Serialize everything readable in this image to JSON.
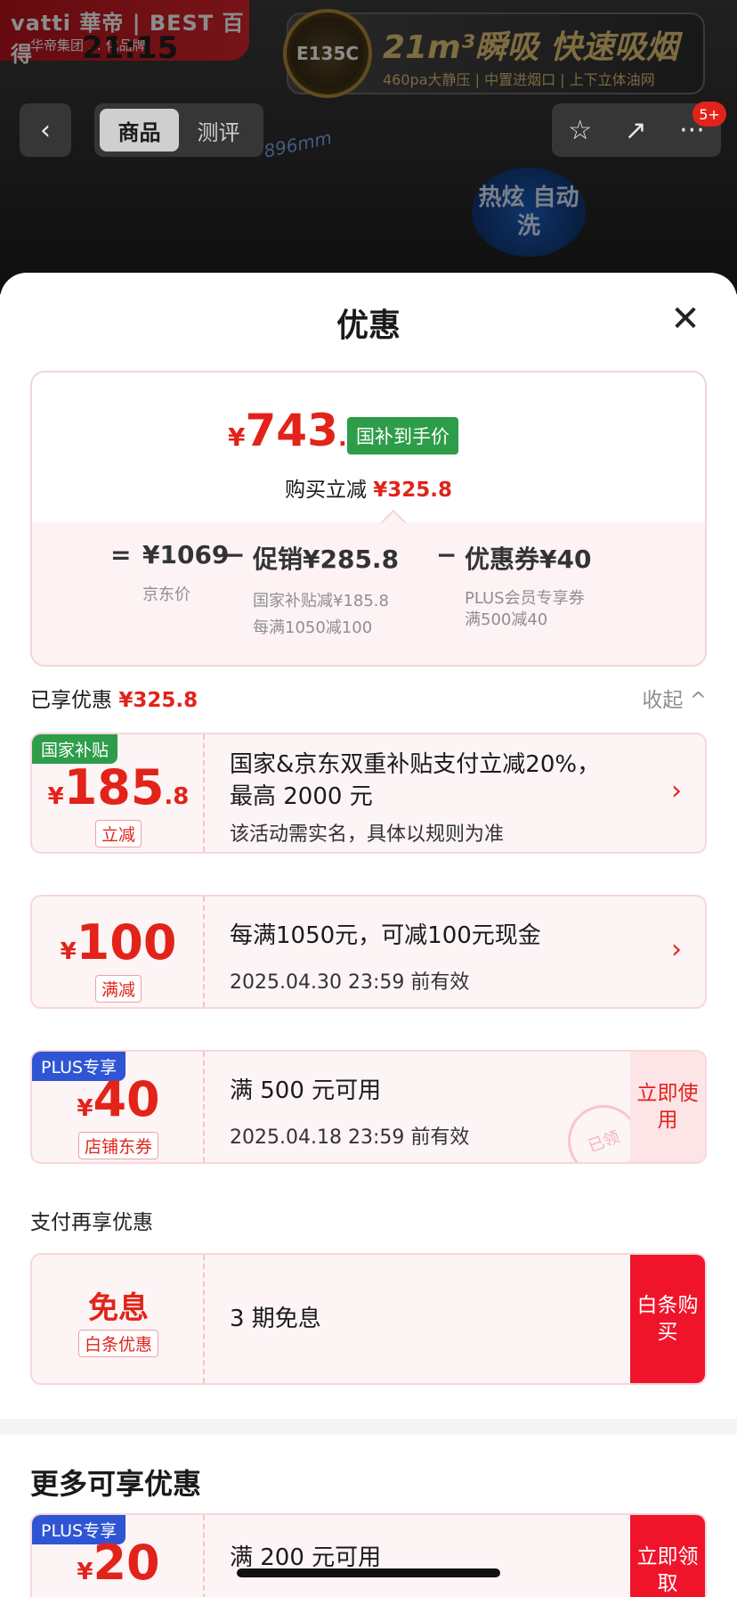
{
  "status": {
    "time": "21:15"
  },
  "hero": {
    "brand_name": "vatti 華帝 | BEST 百得",
    "brand_slogan": "华帝集团 … 化品牌",
    "model_badge": "E135C",
    "headline": "21m³瞬吸 快速吸烟",
    "subline": "460pa大静压 | 中置进烟口 | 上下立体油网",
    "dimension": "896mm",
    "wash_badge": "热炫 自动洗"
  },
  "nav": {
    "back_icon": "‹",
    "tabs": [
      "商品",
      "测评"
    ],
    "active_tab": "商品",
    "star_icon": "☆",
    "share_icon": "↗",
    "more_icon": "···",
    "message_count": "5+"
  },
  "sheet": {
    "title": "优惠",
    "close_icon": "✕",
    "summary": {
      "price_symbol": "¥",
      "price_int": "743",
      "price_dec": ".2",
      "price_tag": "国补到手价",
      "cut_label": "购买立减",
      "cut_amount": "¥325.8",
      "calc": {
        "eq": "=",
        "base_value": "¥1069",
        "base_label": "京东价",
        "minus1": "−",
        "promo_value": "促销¥285.8",
        "promo_note1": "国家补贴减¥185.8",
        "promo_note2": "每满1050减100",
        "minus2": "−",
        "coupon_value": "优惠券¥40",
        "coupon_note1": "PLUS会员专享券",
        "coupon_note2": "满500减40"
      }
    },
    "enjoyed": {
      "label": "已享优惠",
      "amount": "¥325.8",
      "collapse_label": "收起",
      "collapse_icon": "^"
    },
    "coupons": [
      {
        "tag": "国家补贴",
        "symbol": "¥",
        "amount_int": "185",
        "amount_dec": ".8",
        "kind": "立减",
        "line1": "国家&京东双重补贴支付立减20%，",
        "line1b": "最高 2000 元",
        "line2": "该活动需实名，具体以规则为准",
        "chevron": "›"
      },
      {
        "symbol": "¥",
        "amount_int": "100",
        "kind": "满减",
        "line1": "每满1050元，可减100元现金",
        "line2": "2025.04.30 23:59 前有效",
        "chevron": "›"
      },
      {
        "tag": "PLUS专享",
        "symbol": "¥",
        "amount_int": "40",
        "kind": "店铺东券",
        "line1": "满 500 元可用",
        "line2": "2025.04.18 23:59 前有效",
        "action": "立即使用",
        "stamp": "已领"
      }
    ],
    "pay_section": {
      "label": "支付再享优惠",
      "title": "免息",
      "kind": "白条优惠",
      "line1": "3 期免息",
      "action": "白条购买"
    },
    "more": {
      "title": "更多可享优惠",
      "coupon": {
        "tag": "PLUS专享",
        "symbol": "¥",
        "amount_int": "20",
        "line1": "满 200 元可用",
        "action": "立即领取"
      }
    }
  }
}
